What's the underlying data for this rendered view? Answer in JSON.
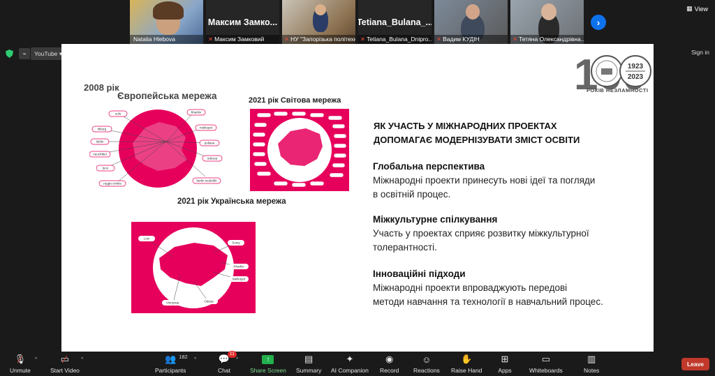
{
  "participants": [
    {
      "caption": "Natalia Hlebova",
      "muted": false
    },
    {
      "big_name": "Максим Замко...",
      "caption": "Максим Замковий",
      "muted": true
    },
    {
      "caption": "НУ \"Запорізька політехн...",
      "muted": true
    },
    {
      "big_name": "Tetiana_Bulana_...",
      "caption": "Tetiana_Bulana_Dnipro...",
      "muted": true
    },
    {
      "caption": "Вадим КУДІН",
      "muted": true
    },
    {
      "caption": "Тетяна Олександрівна...",
      "muted": true
    }
  ],
  "top_right": {
    "view_label": "View"
  },
  "share_bar": {
    "tab_label": "YouTube",
    "signin_label": "Sign in"
  },
  "slide": {
    "logo": {
      "big_number": "100",
      "years": [
        "1923",
        "2023"
      ],
      "caption": "РОКІВ НЕЗЛАМНОСТІ"
    },
    "year_2008": "2008 рік",
    "euro_title": "Європейська мережа",
    "world_title": "2021 рік Світова мережа",
    "ua_title": "2021 рік Українська мережа",
    "heading_line1": "ЯК УЧАСТЬ У МІЖНАРОДНИХ ПРОЕКТАХ",
    "heading_line2": "ДОПОМАГАЄ МОДЕРНІЗУВАТИ ЗМІСТ ОСВІТИ",
    "sections": [
      {
        "title": "Глобальна перспектива",
        "line1": "Міжнародні проекти принесуть нові ідеї та погляди",
        "line2": "в освітній процес."
      },
      {
        "title": "Міжкультурне спілкування",
        "line1": "Участь у проектах сприяє розвитку міжкультурної",
        "line2": "толерантності."
      },
      {
        "title": "Інноваційні підходи",
        "line1": "Міжнародні проекти впроваджують передові",
        "line2": "методи навчання та технології в навчальний процес."
      }
    ],
    "euro_labels": [
      "oulu",
      "kharkiv",
      "tilburg",
      "melitopol",
      "lublin",
      "poltava",
      "neuchâtel",
      "odessa",
      "lyon",
      "reggio emilia",
      "berlin neukölln"
    ],
    "ua_labels": [
      "Lviv",
      "Sumy",
      "Kharkiv",
      "Melitopol",
      "Odesa",
      "Vinnytsia"
    ]
  },
  "toolbar": {
    "unmute": "Unmute",
    "start_video": "Start Video",
    "participants": "Participants",
    "participants_count": "182",
    "chat": "Chat",
    "chat_badge": "11",
    "share_screen": "Share Screen",
    "summary": "Summary",
    "ai_companion": "AI Companion",
    "record": "Record",
    "reactions": "Reactions",
    "raise_hand": "Raise Hand",
    "apps": "Apps",
    "whiteboards": "Whiteboards",
    "notes": "Notes",
    "leave": "Leave"
  },
  "colors": {
    "accent_pink": "#e6005c",
    "zoom_blue": "#0e72ed",
    "leave_red": "#c0392b",
    "share_green": "#22b14c"
  }
}
